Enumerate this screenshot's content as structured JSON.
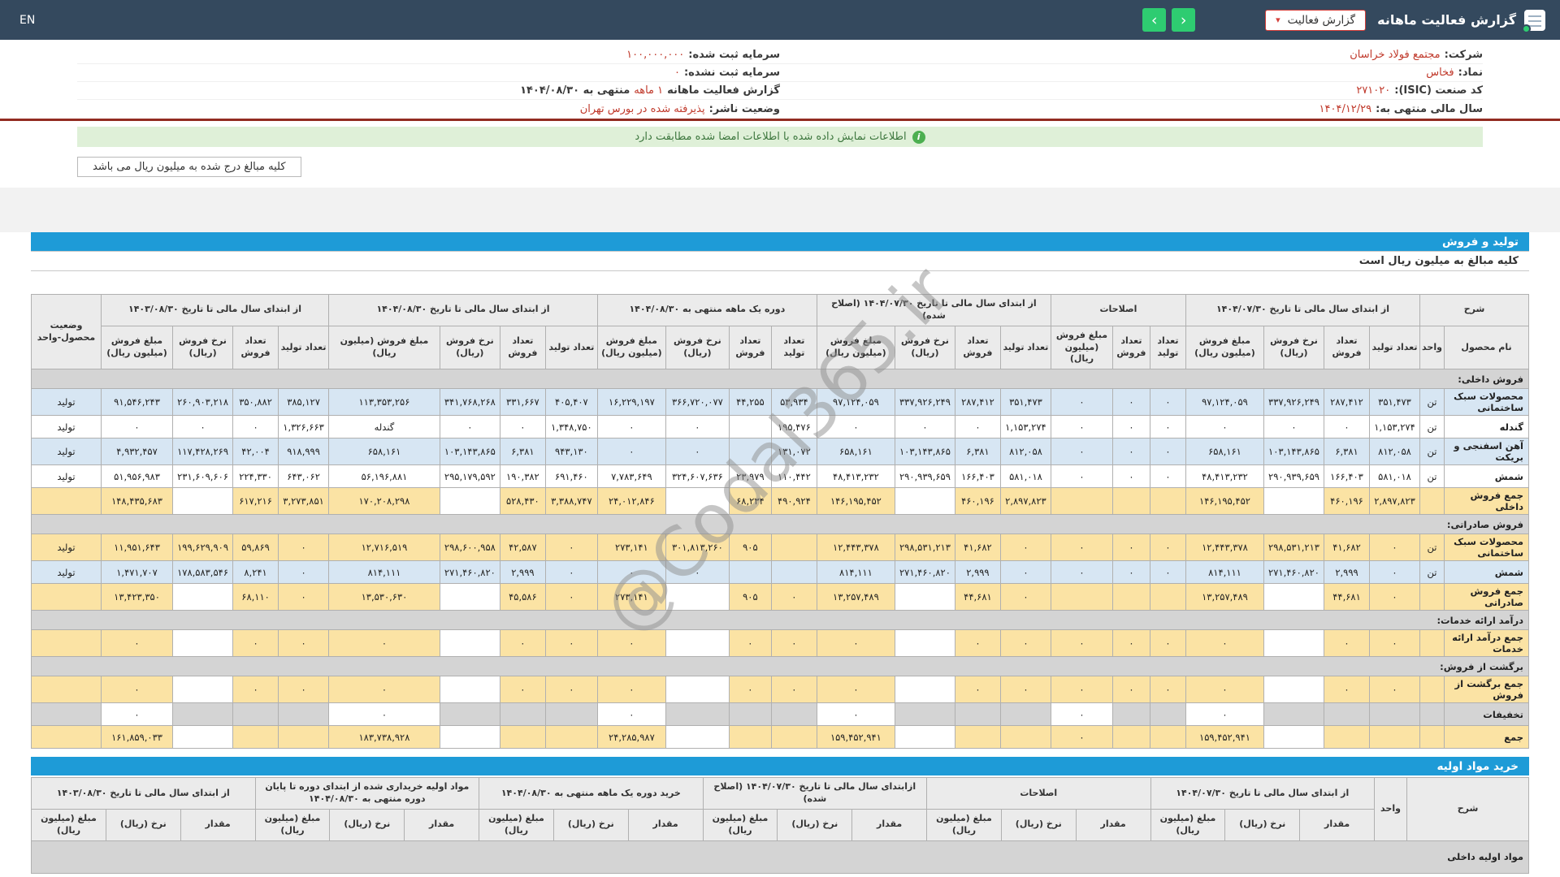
{
  "topbar": {
    "title": "گزارش فعالیت ماهانه",
    "dropdown_label": "گزارش فعالیت",
    "en_label": "EN",
    "icons": {
      "app": "app-logo-icon",
      "dropdown_caret": "caret-down-icon",
      "nav_right": "chevron-left-icon",
      "nav_left": "chevron-right-icon"
    }
  },
  "info": {
    "right": [
      {
        "label": "شرکت:",
        "value": "مجتمع فولاد خراسان"
      },
      {
        "label": "نماد:",
        "value": "فخاس"
      },
      {
        "label": "کد صنعت (ISIC):",
        "value": "۲۷۱۰۲۰"
      },
      {
        "label": "سال مالی منتهی به:",
        "value": "۱۴۰۴/۱۲/۲۹"
      }
    ],
    "left": [
      {
        "label": "سرمایه ثبت شده:",
        "value": "۱۰۰,۰۰۰,۰۰۰"
      },
      {
        "label": "سرمایه ثبت نشده:",
        "value": "۰"
      },
      {
        "label": "گزارش فعالیت ماهانه",
        "value": "۱ ماهه",
        "suffix": "منتهی به ۱۴۰۴/۰۸/۳۰"
      },
      {
        "label": "وضعیت ناشر:",
        "value": "پذیرفته شده در بورس تهران"
      }
    ]
  },
  "alert": {
    "text": "اطلاعات نمایش داده شده با اطلاعات امضا شده مطابقت دارد",
    "icon": "info-icon"
  },
  "note_box": "کلیه مبالغ درج شده به میلیون ریال می باشد",
  "watermark": "@Codal365.ir",
  "colors": {
    "topbar": "#34495e",
    "accent_blue": "#1e9bd7",
    "green_button": "#2ecc71",
    "red_accent": "#d43f3a",
    "value_red": "#c0392b",
    "alert_bg": "#dff0d8",
    "row_blue": "#d7e6f3",
    "row_gold": "#fbe3a4",
    "row_gray": "#d4d4d4"
  },
  "prod": {
    "title": "تولید و فروش",
    "subtitle": "کلیه مبالغ به میلیون ریال است",
    "desc_header": "شرح",
    "name_header": "نام محصول",
    "unit_header": "واحد",
    "status_header": "وضعیت محصول-واحد",
    "groups": [
      {
        "label": "از ابتدای سال مالی تا تاریخ ۱۴۰۴/۰۷/۳۰",
        "cols": 4
      },
      {
        "label": "اصلاحات",
        "cols": 3
      },
      {
        "label": "از ابتدای سال مالی تا تاریخ ۱۴۰۴/۰۷/۳۰ (اصلاح شده)",
        "cols": 4
      },
      {
        "label": "دوره یک ماهه منتهی به ۱۴۰۴/۰۸/۳۰",
        "cols": 4
      },
      {
        "label": "از ابتدای سال مالی تا تاریخ ۱۴۰۴/۰۸/۳۰",
        "cols": 4
      },
      {
        "label": "از ابتدای سال مالی تا تاریخ ۱۴۰۳/۰۸/۳۰",
        "cols": 4
      }
    ],
    "sub4": [
      "تعداد تولید",
      "تعداد فروش",
      "نرخ فروش (ریال)",
      "مبلغ فروش (میلیون ریال)"
    ],
    "sub3": [
      "تعداد تولید",
      "تعداد فروش",
      "مبلغ فروش (میلیون ریال)"
    ],
    "rows": [
      {
        "style": "section",
        "label": "فروش داخلی:"
      },
      {
        "style": "blue",
        "label": "محصولات سبک ساختمانی",
        "unit": "تن",
        "status": "تولید",
        "c": [
          "۳۵۱,۴۷۳",
          "۲۸۷,۴۱۲",
          "۳۳۷,۹۲۶,۲۴۹",
          "۹۷,۱۲۴,۰۵۹",
          "۰",
          "۰",
          "۰",
          "۳۵۱,۴۷۳",
          "۲۸۷,۴۱۲",
          "۳۳۷,۹۲۶,۲۴۹",
          "۹۷,۱۲۴,۰۵۹",
          "۵۳,۹۳۴",
          "۴۴,۲۵۵",
          "۳۶۶,۷۲۰,۰۷۷",
          "۱۶,۲۲۹,۱۹۷",
          "۴۰۵,۴۰۷",
          "۳۳۱,۶۶۷",
          "۳۴۱,۷۶۸,۲۶۸",
          "۱۱۳,۳۵۳,۲۵۶",
          "۳۸۵,۱۲۷",
          "۳۵۰,۸۸۲",
          "۲۶۰,۹۰۳,۲۱۸",
          "۹۱,۵۴۶,۲۴۳"
        ]
      },
      {
        "style": "white",
        "label": "گندله",
        "unit": "تن",
        "status": "تولید",
        "c": [
          "۱,۱۵۳,۲۷۴",
          "۰",
          "۰",
          "۰",
          "۰",
          "۰",
          "۰",
          "۱,۱۵۳,۲۷۴",
          "۰",
          "۰",
          "۰",
          "۱۹۵,۴۷۶",
          "",
          "۰",
          "۰",
          "۱,۳۴۸,۷۵۰",
          "۰",
          "۰",
          "گندله",
          "۱,۳۲۶,۶۶۳",
          "۰",
          "۰",
          "۰"
        ]
      },
      {
        "style": "blue",
        "label": "آهن اسفنجی و بریکت",
        "unit": "تن",
        "status": "تولید",
        "c": [
          "۸۱۲,۰۵۸",
          "۶,۳۸۱",
          "۱۰۳,۱۴۳,۸۶۵",
          "۶۵۸,۱۶۱",
          "۰",
          "۰",
          "۰",
          "۸۱۲,۰۵۸",
          "۶,۳۸۱",
          "۱۰۳,۱۴۳,۸۶۵",
          "۶۵۸,۱۶۱",
          "۱۳۱,۰۷۲",
          "",
          "۰",
          "۰",
          "۹۴۳,۱۳۰",
          "۶,۳۸۱",
          "۱۰۳,۱۴۳,۸۶۵",
          "۶۵۸,۱۶۱",
          "۹۱۸,۹۹۹",
          "۴۲,۰۰۴",
          "۱۱۷,۴۲۸,۲۶۹",
          "۴,۹۳۲,۴۵۷"
        ]
      },
      {
        "style": "white",
        "label": "شمش",
        "unit": "تن",
        "status": "تولید",
        "c": [
          "۵۸۱,۰۱۸",
          "۱۶۶,۴۰۳",
          "۲۹۰,۹۳۹,۶۵۹",
          "۴۸,۴۱۳,۲۳۲",
          "۰",
          "۰",
          "۰",
          "۵۸۱,۰۱۸",
          "۱۶۶,۴۰۳",
          "۲۹۰,۹۳۹,۶۵۹",
          "۴۸,۴۱۳,۲۳۲",
          "۱۱۰,۴۴۲",
          "۲۳,۹۷۹",
          "۳۲۴,۶۰۷,۶۳۶",
          "۷,۷۸۳,۶۴۹",
          "۶۹۱,۴۶۰",
          "۱۹۰,۳۸۲",
          "۲۹۵,۱۷۹,۵۹۲",
          "۵۶,۱۹۶,۸۸۱",
          "۶۴۳,۰۶۲",
          "۲۲۴,۳۳۰",
          "۲۳۱,۶۰۹,۶۰۶",
          "۵۱,۹۵۶,۹۸۳"
        ]
      },
      {
        "style": "total",
        "label": "جمع فروش داخلی",
        "unit": "",
        "status": "",
        "c": [
          "۲,۸۹۷,۸۲۳",
          "۴۶۰,۱۹۶",
          "",
          "۱۴۶,۱۹۵,۴۵۲",
          "",
          "",
          "",
          "۲,۸۹۷,۸۲۳",
          "۴۶۰,۱۹۶",
          "",
          "۱۴۶,۱۹۵,۴۵۲",
          "۴۹۰,۹۲۴",
          "۶۸,۲۳۴",
          "",
          "۲۴,۰۱۲,۸۴۶",
          "۳,۳۸۸,۷۴۷",
          "۵۲۸,۴۳۰",
          "",
          "۱۷۰,۲۰۸,۲۹۸",
          "۳,۲۷۳,۸۵۱",
          "۶۱۷,۲۱۶",
          "",
          "۱۴۸,۴۳۵,۶۸۳"
        ]
      },
      {
        "style": "section",
        "label": "فروش صادراتی:"
      },
      {
        "style": "gold",
        "label": "محصولات سبک ساختمانی",
        "unit": "تن",
        "status": "تولید",
        "c": [
          "۰",
          "۴۱,۶۸۲",
          "۲۹۸,۵۳۱,۲۱۳",
          "۱۲,۴۴۳,۳۷۸",
          "۰",
          "۰",
          "۰",
          "۰",
          "۴۱,۶۸۲",
          "۲۹۸,۵۳۱,۲۱۳",
          "۱۲,۴۴۳,۳۷۸",
          "",
          "۹۰۵",
          "۳۰۱,۸۱۳,۲۶۰",
          "۲۷۳,۱۴۱",
          "۰",
          "۴۲,۵۸۷",
          "۲۹۸,۶۰۰,۹۵۸",
          "۱۲,۷۱۶,۵۱۹",
          "۰",
          "۵۹,۸۶۹",
          "۱۹۹,۶۲۹,۹۰۹",
          "۱۱,۹۵۱,۶۴۳"
        ]
      },
      {
        "style": "blue",
        "label": "شمش",
        "unit": "تن",
        "status": "تولید",
        "c": [
          "۰",
          "۲,۹۹۹",
          "۲۷۱,۴۶۰,۸۲۰",
          "۸۱۴,۱۱۱",
          "۰",
          "۰",
          "۰",
          "۰",
          "۲,۹۹۹",
          "۲۷۱,۴۶۰,۸۲۰",
          "۸۱۴,۱۱۱",
          "",
          "",
          "۰",
          "۰",
          "۰",
          "۲,۹۹۹",
          "۲۷۱,۴۶۰,۸۲۰",
          "۸۱۴,۱۱۱",
          "۰",
          "۸,۲۴۱",
          "۱۷۸,۵۸۳,۵۴۶",
          "۱,۴۷۱,۷۰۷"
        ]
      },
      {
        "style": "total",
        "label": "جمع فروش صادراتی",
        "unit": "",
        "status": "",
        "c": [
          "۰",
          "۴۴,۶۸۱",
          "",
          "۱۳,۲۵۷,۴۸۹",
          "",
          "",
          "",
          "۰",
          "۴۴,۶۸۱",
          "",
          "۱۳,۲۵۷,۴۸۹",
          "۰",
          "۹۰۵",
          "",
          "۲۷۳,۱۴۱",
          "۰",
          "۴۵,۵۸۶",
          "",
          "۱۳,۵۳۰,۶۳۰",
          "۰",
          "۶۸,۱۱۰",
          "",
          "۱۳,۴۲۳,۳۵۰"
        ]
      },
      {
        "style": "section",
        "label": "درآمد ارائه خدمات:"
      },
      {
        "style": "total",
        "label": "جمع درآمد ارائه خدمات",
        "unit": "",
        "status": "",
        "c": [
          "۰",
          "۰",
          "",
          "۰",
          "۰",
          "۰",
          "۰",
          "۰",
          "۰",
          "",
          "۰",
          "۰",
          "۰",
          "",
          "۰",
          "۰",
          "۰",
          "",
          "۰",
          "۰",
          "۰",
          "",
          "۰"
        ]
      },
      {
        "style": "section",
        "label": "برگشت از فروش:"
      },
      {
        "style": "total",
        "label": "جمع برگشت از فروش",
        "unit": "",
        "status": "",
        "c": [
          "۰",
          "۰",
          "",
          "۰",
          "۰",
          "۰",
          "۰",
          "۰",
          "۰",
          "",
          "۰",
          "۰",
          "۰",
          "",
          "۰",
          "۰",
          "۰",
          "",
          "۰",
          "۰",
          "۰",
          "",
          "۰"
        ]
      },
      {
        "style": "discount",
        "label": "تخفیفات",
        "unit": "",
        "status": "",
        "c": [
          "",
          "",
          "",
          "۰",
          "",
          "",
          "۰",
          "",
          "",
          "",
          "۰",
          "",
          "",
          "",
          "۰",
          "",
          "",
          "",
          "۰",
          "",
          "",
          "",
          "۰"
        ]
      },
      {
        "style": "total",
        "label": "جمع",
        "unit": "",
        "status": "",
        "c": [
          "",
          "",
          "",
          "۱۵۹,۴۵۲,۹۴۱",
          "",
          "",
          "۰",
          "",
          "",
          "",
          "۱۵۹,۴۵۲,۹۴۱",
          "",
          "",
          "",
          "۲۴,۲۸۵,۹۸۷",
          "",
          "",
          "",
          "۱۸۳,۷۳۸,۹۲۸",
          "",
          "",
          "",
          "۱۶۱,۸۵۹,۰۳۳"
        ]
      }
    ]
  },
  "materials": {
    "title": "خرید مواد اولیه",
    "desc_header": "شرح",
    "unit_header": "واحد",
    "groups": [
      {
        "label": "از ابتدای سال مالی تا تاریخ ۱۴۰۴/۰۷/۳۰"
      },
      {
        "label": "اصلاحات"
      },
      {
        "label": "ازابتدای سال مالی تا تاریخ ۱۴۰۴/۰۷/۳۰ (اصلاح شده)"
      },
      {
        "label": "خرید دوره یک ماهه منتهی به ۱۴۰۴/۰۸/۳۰"
      },
      {
        "label": "مواد اولیه خریداری شده از ابتدای دوره تا پایان دوره منتهی به ۱۴۰۴/۰۸/۳۰"
      },
      {
        "label": "از ابتدای سال مالی تا تاریخ ۱۴۰۳/۰۸/۳۰"
      }
    ],
    "sub": [
      "مقدار",
      "نرخ (ریال)",
      "مبلغ (میلیون ریال)"
    ],
    "rows": [
      {
        "style": "section",
        "label": "مواد اولیه داخلی"
      }
    ]
  }
}
